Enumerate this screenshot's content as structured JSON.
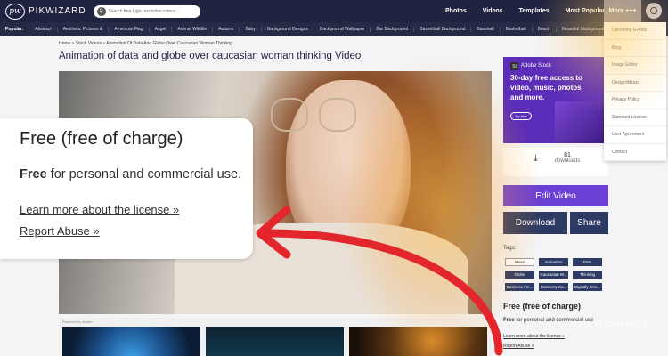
{
  "header": {
    "logo_mark": "pw",
    "logo_text": "PIKWIZARD",
    "search_placeholder": "Search free high-resolution videos...",
    "nav": [
      "Photos",
      "Videos",
      "Templates",
      "Most Popular"
    ],
    "more_label": "More +++"
  },
  "categories": {
    "label": "Popular:",
    "items": [
      "Abstract",
      "Aesthetic Pictures &",
      "American Flag",
      "Angel",
      "Animal Wildlife",
      "Autumn",
      "Baby",
      "Background Designs",
      "Background Wallpaper",
      "Bar Background",
      "Basketball Background",
      "Baseball",
      "Basketball",
      "Beach",
      "Beautiful Background"
    ]
  },
  "breadcrumb": "Home » Stock Videos » Animation Of Data And Globe Over Caucasian Woman Thinking",
  "page_title": "Animation of data and globe over caucasian woman thinking Video",
  "license_popup": {
    "heading": "Free (free of charge)",
    "bold": "Free",
    "text": " for personal and commercial use.",
    "learn_more": "Learn more about the license »",
    "report": "Report Abuse »"
  },
  "thumbs_label": "Powered by Adobe",
  "adobe_ad": {
    "badge": "St",
    "brand": "Adobe Stock",
    "headline": "30-day free access to video, music, photos and more.",
    "cta": "Try free"
  },
  "downloads": {
    "count": "81",
    "label": "downloads"
  },
  "buttons": {
    "edit": "Edit Video",
    "download": "Download",
    "share": "Share"
  },
  "tags": {
    "label": "Tags:",
    "items": [
      "More",
      "Animation",
      "Data",
      "Globe",
      "Caucasian W...",
      "Thinking",
      "Business Fin...",
      "Economy Co...",
      "Digitally Gen..."
    ]
  },
  "sidebar_license": {
    "heading": "Free (free of charge)",
    "bold": "Free",
    "text": " for personal and commercial use",
    "learn_more": "Learn more about the license »",
    "report": "Report Abuse »"
  },
  "watermark": "POLYTECHPRESS",
  "dropdown": [
    "Upcoming Events",
    "Blog",
    "Image Editor",
    "DesignWizard",
    "Privacy Policy",
    "Standard License",
    "User Agreement",
    "Contact"
  ],
  "colors": {
    "navy": "#1f2340",
    "purple": "#6a3fd6",
    "arrow": "#e3262b",
    "adobe": "#5b2db8"
  }
}
